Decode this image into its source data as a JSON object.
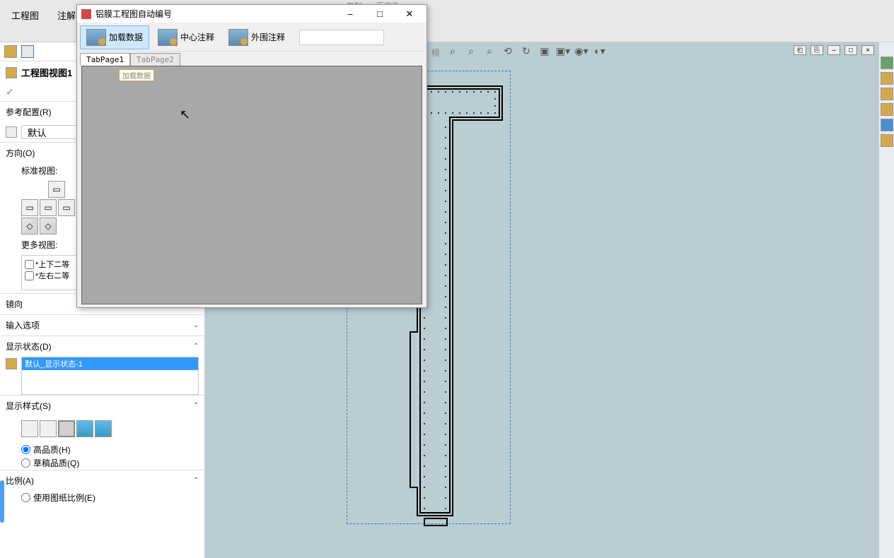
{
  "ribbon": {
    "tabs": [
      "工程图",
      "注解"
    ],
    "partial_items": [
      "复制",
      "压缩孔",
      "模"
    ]
  },
  "panel": {
    "title": "工程图视图1",
    "ref_config_label": "参考配置(R)",
    "ref_config_value": "默认",
    "direction_label": "方向(O)",
    "standard_view_label": "标准视图:",
    "more_view_label": "更多视图:",
    "more_views": [
      "*上下二等",
      "*左右二等"
    ],
    "mirror_label": "镜向",
    "input_options_label": "输入选项",
    "display_state_label": "显示状态(D)",
    "display_state_item": "默认_显示状态-1",
    "display_style_label": "显示样式(S)",
    "quality_high": "高品质(H)",
    "quality_draft": "草稿品质(Q)",
    "scale_label": "比例(A)",
    "scale_sheet": "使用图纸比例(E)"
  },
  "dialog": {
    "title": "铝膜工程图自动编号",
    "btn_load": "加载数据",
    "btn_center": "中心注释",
    "btn_outer": "外围注释",
    "tab1": "TabPage1",
    "tab2": "TabPage2",
    "tooltip": "加载数据"
  }
}
